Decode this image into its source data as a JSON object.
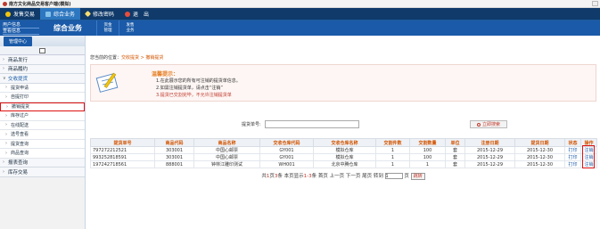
{
  "window": {
    "title": "南方文化商品交易客户端(模拟)"
  },
  "topnav": [
    {
      "label": "发售交易",
      "icon": "gear-icon",
      "active": false
    },
    {
      "label": "综合业务",
      "icon": "document-icon",
      "active": true
    },
    {
      "label": "修改密码",
      "icon": "key-icon",
      "active": false
    },
    {
      "label": "退　出",
      "icon": "power-icon",
      "active": false
    }
  ],
  "subnav": {
    "user_info": "用户信息",
    "view_info": "查看信息",
    "module": "综合业务",
    "items": [
      {
        "line1": "资金",
        "line2": "管理"
      },
      {
        "line1": "发售",
        "line2": "业务"
      }
    ]
  },
  "sidebar": {
    "header": "管理中心",
    "items": [
      {
        "label": "商品发行",
        "type": "group"
      },
      {
        "label": "商品履约",
        "type": "group"
      },
      {
        "label": "交收提货",
        "type": "group-open"
      },
      {
        "label": "提货申请",
        "type": "sub"
      },
      {
        "label": "自提打印",
        "type": "sub"
      },
      {
        "label": "撤销提货",
        "type": "sub-current"
      },
      {
        "label": "库存过户",
        "type": "sub"
      },
      {
        "label": "在线配送",
        "type": "sub"
      },
      {
        "label": "选号查看",
        "type": "sub"
      },
      {
        "label": "提货查询",
        "type": "sub"
      },
      {
        "label": "商品查询",
        "type": "sub"
      },
      {
        "label": "报表查询",
        "type": "group"
      },
      {
        "label": "库存交易",
        "type": "group"
      }
    ]
  },
  "breadcrumb": {
    "prefix": "您当前的位置：",
    "path": "交收提货 > 撤销提货"
  },
  "notice": {
    "title": "温馨提示：",
    "lines": [
      "1.在此展示您的所有可注销的提货单信息。",
      "2.如需注销提货单，请点击“注销”",
      "3.提货已交割完毕，不允许注销提货单"
    ]
  },
  "search": {
    "label": "提货单号:",
    "value": "",
    "button": "立即搜索"
  },
  "table": {
    "headers": [
      "提货单号",
      "商品代码",
      "商品名称",
      "交收仓库代码",
      "交收仓库名称",
      "交割件数",
      "交割数量",
      "单位",
      "注册日期",
      "提货日期",
      "状态",
      "操作"
    ],
    "rows": [
      [
        "797272212521",
        "303001",
        "中国心邮票",
        "GY001",
        "模拟仓库",
        "1",
        "100",
        "套",
        "2015-12-29",
        "2015-12-30",
        "打印",
        "注销"
      ],
      [
        "993252818591",
        "303001",
        "中国心邮票",
        "GY001",
        "模拟仓库",
        "1",
        "100",
        "套",
        "2015-12-29",
        "2015-12-30",
        "打印",
        "注销"
      ],
      [
        "197242718561",
        "888001",
        "钟林江雕印测试",
        "WH001",
        "北京中腾仓库",
        "1",
        "1",
        "套",
        "2015-12-29",
        "2015-12-30",
        "打印",
        "注销"
      ]
    ]
  },
  "pager": {
    "text1": "共",
    "total": "1",
    "text2": "页",
    "records": "3",
    "text3": "条 本页显示",
    "range": "1-3",
    "text4": "条 首页 上一页 下一页 尾页 转到",
    "page": "1",
    "text5": "页",
    "go": "跳转"
  }
}
